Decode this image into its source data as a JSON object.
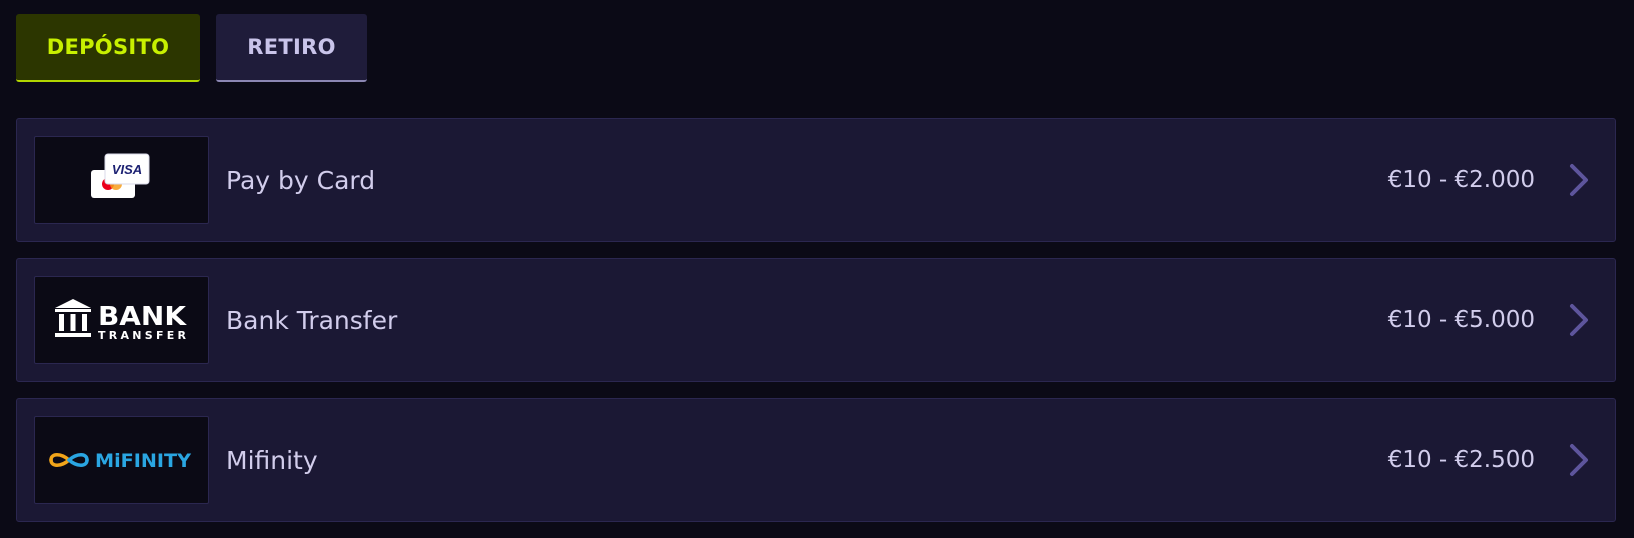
{
  "tabs": {
    "deposit_label": "DEPÓSITO",
    "withdraw_label": "RETIRO",
    "active": "deposit"
  },
  "methods": [
    {
      "name": "Pay by Card",
      "range": "€10 - €2.000",
      "logo": "visa-mastercard-icon"
    },
    {
      "name": "Bank Transfer",
      "range": "€10 - €5.000",
      "logo": "bank-transfer-logo"
    },
    {
      "name": "Mifinity",
      "range": "€10 - €2.500",
      "logo": "mifinity-logo"
    }
  ],
  "logos": {
    "visa_text": "VISA",
    "bank_text": "BANK",
    "transfer_text": "TRANSFER",
    "mifinity_text": "MiFINITY"
  },
  "colors": {
    "background": "#0b0a16",
    "active_tab_text": "#c8f000",
    "active_tab_bg": "#2c3600",
    "card_bg": "#1b1834",
    "chevron": "#5e559c"
  }
}
